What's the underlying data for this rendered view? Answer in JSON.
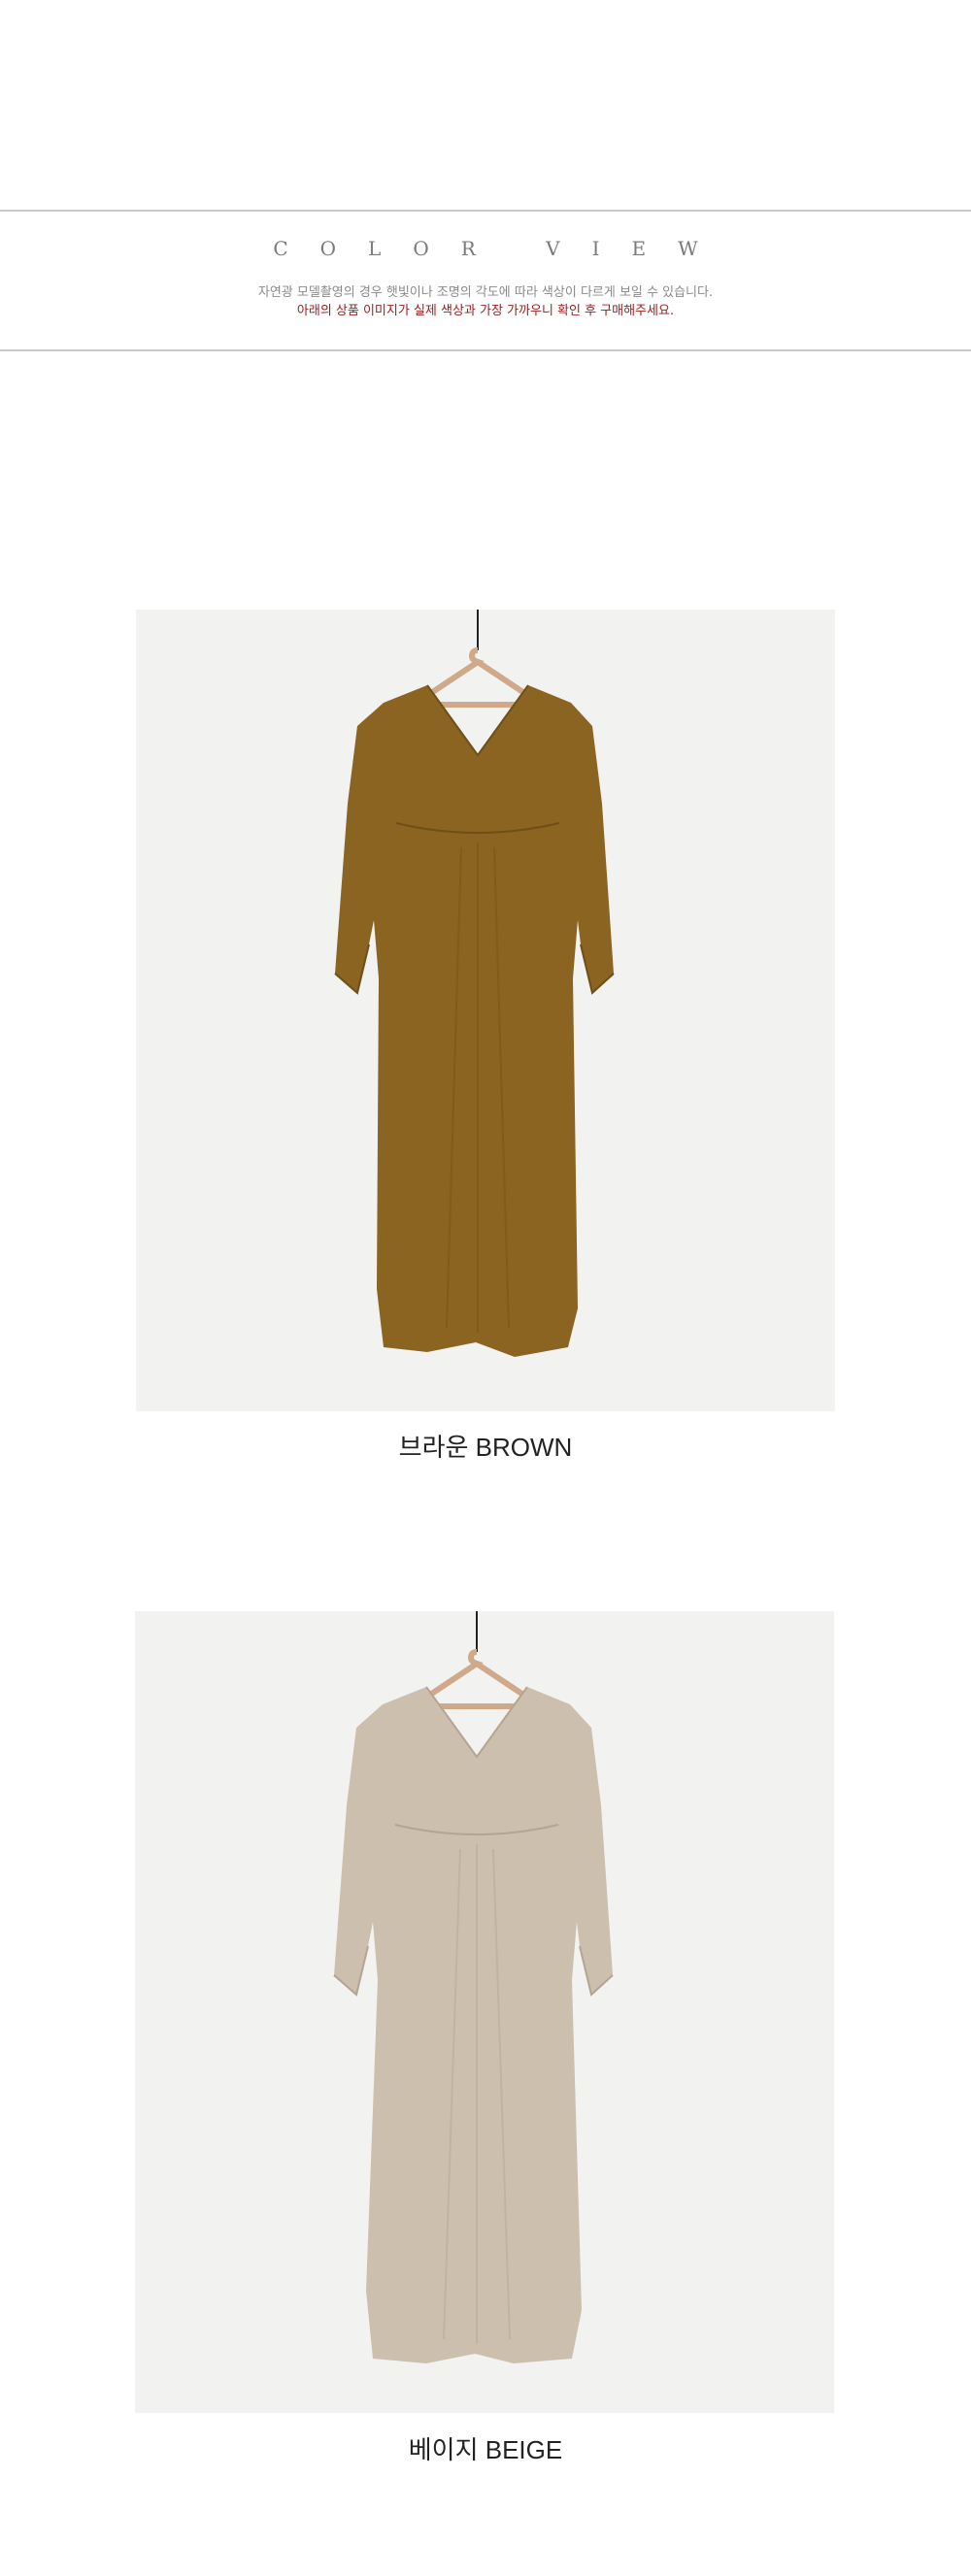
{
  "header": {
    "title": "COLOR VIEW",
    "note_line1": "자연광 모델촬영의 경우 햇빛이나 조명의 각도에 따라 색상이 다르게 보일 수 있습니다.",
    "note_line2": "아래의 상품 이미지가 실제 색상과 가장 가까우니 확인 후 구매해주세요."
  },
  "colors": [
    {
      "caption": "브라운 BROWN",
      "swatch": "#8a6420"
    },
    {
      "caption": "베이지 BEIGE",
      "swatch": "#cdbfae"
    }
  ],
  "theme": {
    "note_red": "#9b1b1b",
    "rule": "#c9c9c9"
  }
}
